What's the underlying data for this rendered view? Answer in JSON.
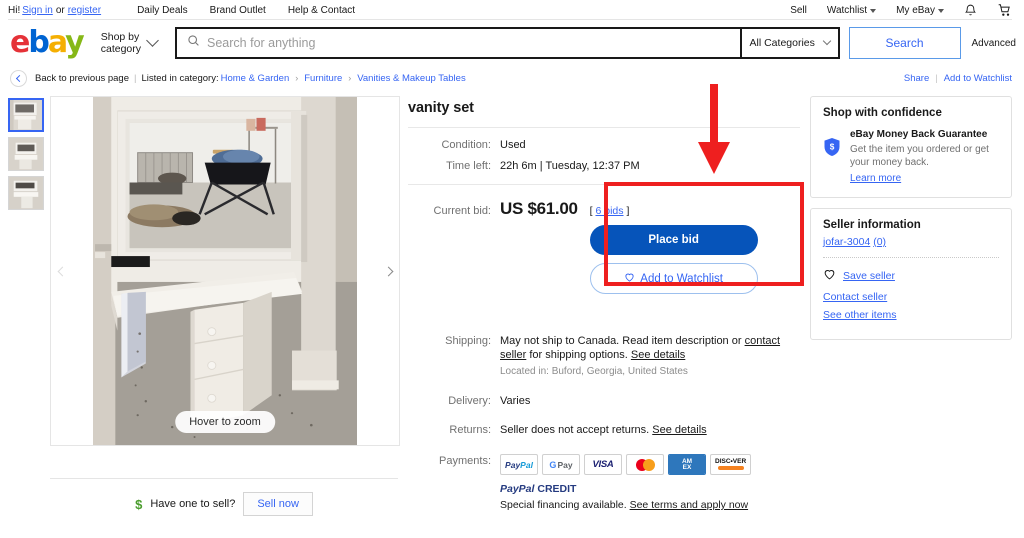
{
  "utility_bar": {
    "greeting": "Hi!",
    "sign_in": "Sign in",
    "or": "or",
    "register": "register",
    "nav": [
      "Daily Deals",
      "Brand Outlet",
      "Help & Contact"
    ],
    "right": [
      "Sell",
      "Watchlist",
      "My eBay"
    ],
    "bell_icon": "notification-bell-icon",
    "cart_icon": "shopping-cart-icon"
  },
  "header": {
    "logo": {
      "e": "e",
      "b": "b",
      "a": "a",
      "y": "y"
    },
    "shop_by": "Shop by\ncategory",
    "shop_by_line1": "Shop by",
    "shop_by_line2": "category",
    "search_placeholder": "Search for anything",
    "search_value": "",
    "category_selected": "All Categories",
    "search_button": "Search",
    "advanced": "Advanced",
    "search_icon": "magnifier-icon"
  },
  "breadcrumb": {
    "back": "Back to previous page",
    "listed_label": "Listed in category:",
    "trail": [
      "Home & Garden",
      "Furniture",
      "Vanities & Makeup Tables"
    ],
    "share": "Share",
    "add_to_watchlist": "Add to Watchlist"
  },
  "gallery": {
    "thumbnails": [
      {
        "name": "thumbnail-1",
        "selected": true
      },
      {
        "name": "thumbnail-2",
        "selected": false
      },
      {
        "name": "thumbnail-3",
        "selected": false
      }
    ],
    "hover_zoom": "Hover to zoom",
    "prev_icon": "chevron-left-icon",
    "next_icon": "chevron-right-icon",
    "sell_prompt": "Have one to sell?",
    "sell_button": "Sell now"
  },
  "item": {
    "title": "vanity set",
    "condition_label": "Condition:",
    "condition_value": "Used",
    "time_left_label": "Time left:",
    "time_left_value": "22h 6m | Tuesday, 12:37 PM",
    "current_bid_label": "Current bid:",
    "current_bid_value": "US $61.00",
    "bids_open": "[",
    "bids_text": "6 bids",
    "bids_close": "]",
    "place_bid": "Place bid",
    "add_to_watchlist": "Add to Watchlist",
    "heart_icon": "heart-outline-icon",
    "shipping_label": "Shipping:",
    "shipping_text_1": "May not ship to Canada. Read item description or ",
    "shipping_contact_seller": "contact seller",
    "shipping_text_2": " for shipping options. ",
    "shipping_see_details": "See details",
    "located_in": "Located in: Buford, Georgia, United States",
    "delivery_label": "Delivery:",
    "delivery_value": "Varies",
    "returns_label": "Returns:",
    "returns_text": "Seller does not accept returns. ",
    "returns_see_details": "See details",
    "payments_label": "Payments:",
    "payment_methods": [
      "PayPal",
      "G Pay",
      "VISA",
      "Mastercard",
      "AMEX",
      "DISCOVER"
    ],
    "paypal_credit_1": "PayPal",
    "paypal_credit_2": "CREDIT",
    "financing_text": "Special financing available. ",
    "financing_link": "See terms and apply now"
  },
  "sidebar": {
    "confidence": {
      "title": "Shop with confidence",
      "mbg_heading": "eBay Money Back Guarantee",
      "mbg_desc": "Get the item you ordered or get your money back.",
      "learn_more": "Learn more",
      "shield_icon": "money-back-shield-icon"
    },
    "seller": {
      "title": "Seller information",
      "name": "jofar-3004",
      "feedback": "(0)",
      "save_seller": "Save seller",
      "contact_seller": "Contact seller",
      "see_other_items": "See other items",
      "heart_icon": "heart-outline-icon"
    }
  },
  "annotation": {
    "box_color": "#ee1f1f",
    "arrow_color": "#ee1f1f",
    "target": "Place bid / Add to Watchlist call-to-action area"
  }
}
